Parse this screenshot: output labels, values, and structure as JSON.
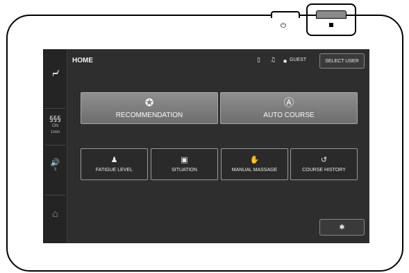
{
  "device": {
    "power_icon": "⏻",
    "callout_indicator": "■"
  },
  "sidebar": {
    "seat_icon": "chair-icon",
    "heat": {
      "icon": "heat-waves-icon",
      "glyph": "§§§",
      "state": "ON",
      "time": "1min"
    },
    "volume": {
      "icon": "speaker-icon",
      "glyph": "🔊",
      "level": "3"
    },
    "home": {
      "icon": "home-icon",
      "glyph": "⌂"
    }
  },
  "header": {
    "title": "HOME",
    "phone_glyph": "▯",
    "music_glyph": "♫",
    "user_glyph": "●",
    "user_label": "GUEST",
    "select_user_label": "SELECT USER"
  },
  "main": {
    "big_tiles": [
      {
        "label": "RECOMMENDATION",
        "icon": "award-ribbon-icon",
        "glyph": "✪"
      },
      {
        "label": "AUTO COURSE",
        "icon": "auto-course-icon",
        "glyph": "Ⓐ"
      }
    ],
    "small_tiles": [
      {
        "label": "FATIGUE LEVEL",
        "icon": "person-icon",
        "glyph": "♟"
      },
      {
        "label": "SITUATION",
        "icon": "picture-icon",
        "glyph": "▣"
      },
      {
        "label": "MANUAL MASSAGE",
        "icon": "massage-hands-icon",
        "glyph": "✋"
      },
      {
        "label": "COURSE HISTORY",
        "icon": "history-clock-icon",
        "glyph": "↺"
      }
    ],
    "settings_glyph": "✱"
  },
  "colors": {
    "screen_bg": "#2e2e2e",
    "sidebar_bg": "#242424",
    "big_tile_bg": "#7e7e7e",
    "device_border": "#000000"
  }
}
